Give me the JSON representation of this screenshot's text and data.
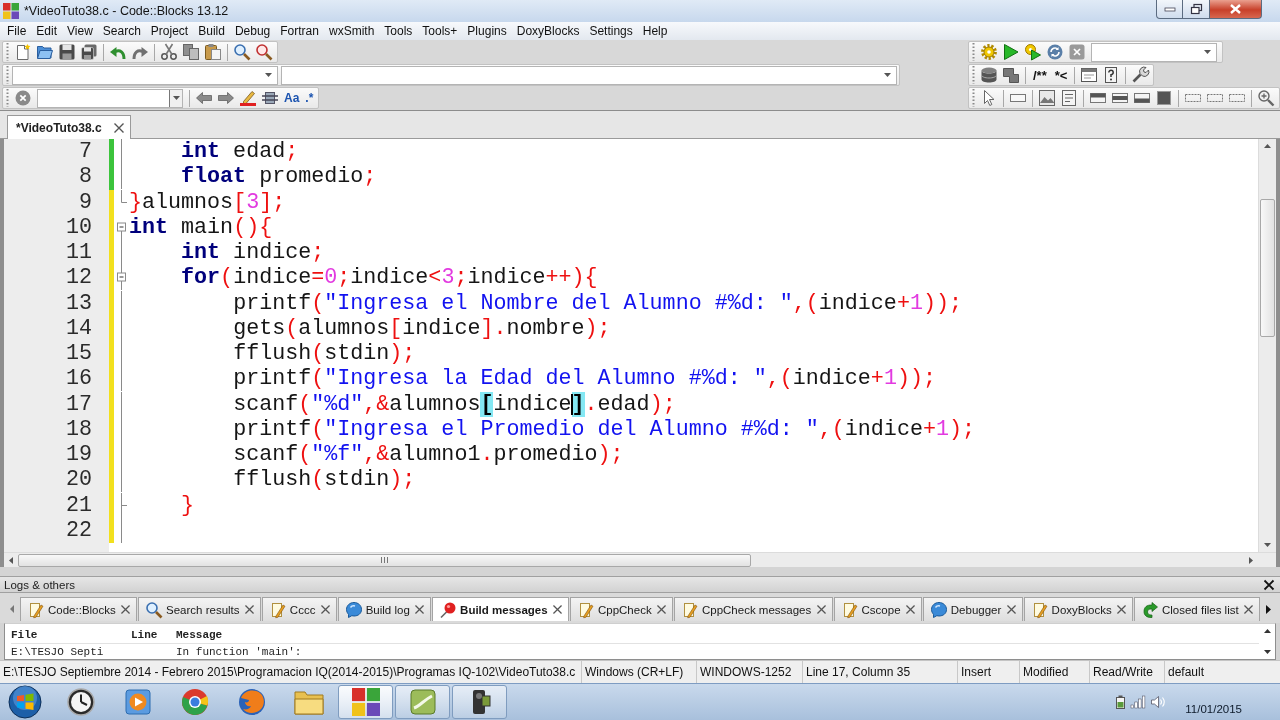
{
  "window": {
    "title": "*VideoTuto38.c - Code::Blocks 13.12"
  },
  "menu": [
    "File",
    "Edit",
    "View",
    "Search",
    "Project",
    "Build",
    "Debug",
    "Fortran",
    "wxSmith",
    "Tools",
    "Tools+",
    "Plugins",
    "DoxyBlocks",
    "Settings",
    "Help"
  ],
  "search_toolbar": {
    "buttons": [
      "Aa",
      ".*"
    ]
  },
  "doxyblocks_toolbar": {
    "buttons": [
      "/**",
      "*<"
    ]
  },
  "editor_tabs": [
    {
      "label": "*VideoTuto38.c",
      "selected": true
    }
  ],
  "editor": {
    "lines": [
      {
        "number": "7",
        "saved": true,
        "fold_start": false,
        "fold_end": false,
        "tokens": [
          {
            "kind": "keyword",
            "text": "    int"
          },
          {
            "kind": "plain",
            "text": " edad"
          },
          {
            "kind": "operator",
            "text": ";"
          }
        ]
      },
      {
        "number": "8",
        "saved": true,
        "fold_start": false,
        "fold_end": false,
        "tokens": [
          {
            "kind": "keyword",
            "text": "    float"
          },
          {
            "kind": "plain",
            "text": " promedio"
          },
          {
            "kind": "operator",
            "text": ";"
          }
        ]
      },
      {
        "number": "9",
        "saved": false,
        "fold_start": false,
        "fold_end": true,
        "tokens": [
          {
            "kind": "operator",
            "text": "}"
          },
          {
            "kind": "plain",
            "text": "alumnos"
          },
          {
            "kind": "operator",
            "text": "["
          },
          {
            "kind": "number",
            "text": "3"
          },
          {
            "kind": "operator",
            "text": "];"
          }
        ]
      },
      {
        "number": "10",
        "saved": false,
        "fold_start": true,
        "fold_end": false,
        "tokens": [
          {
            "kind": "keyword",
            "text": "int"
          },
          {
            "kind": "plain",
            "text": " main"
          },
          {
            "kind": "operator",
            "text": "(){"
          }
        ]
      },
      {
        "number": "11",
        "saved": false,
        "fold_start": false,
        "fold_end": false,
        "tokens": [
          {
            "kind": "keyword",
            "text": "    int"
          },
          {
            "kind": "plain",
            "text": " indice"
          },
          {
            "kind": "operator",
            "text": ";"
          }
        ]
      },
      {
        "number": "12",
        "saved": false,
        "fold_start": true,
        "fold_end": false,
        "tokens": [
          {
            "kind": "keyword",
            "text": "    for"
          },
          {
            "kind": "operator",
            "text": "("
          },
          {
            "kind": "plain",
            "text": "indice"
          },
          {
            "kind": "operator",
            "text": "="
          },
          {
            "kind": "number",
            "text": "0"
          },
          {
            "kind": "operator",
            "text": ";"
          },
          {
            "kind": "plain",
            "text": "indice"
          },
          {
            "kind": "operator",
            "text": "<"
          },
          {
            "kind": "number",
            "text": "3"
          },
          {
            "kind": "operator",
            "text": ";"
          },
          {
            "kind": "plain",
            "text": "indice"
          },
          {
            "kind": "operator",
            "text": "++){"
          }
        ]
      },
      {
        "number": "13",
        "saved": false,
        "fold_start": false,
        "fold_end": false,
        "tokens": [
          {
            "kind": "plain",
            "text": "        printf"
          },
          {
            "kind": "operator",
            "text": "("
          },
          {
            "kind": "string",
            "text": "\"Ingresa el Nombre del Alumno #%d: \""
          },
          {
            "kind": "operator",
            "text": ",("
          },
          {
            "kind": "plain",
            "text": "indice"
          },
          {
            "kind": "operator",
            "text": "+"
          },
          {
            "kind": "number",
            "text": "1"
          },
          {
            "kind": "operator",
            "text": "));"
          }
        ]
      },
      {
        "number": "14",
        "saved": false,
        "fold_start": false,
        "fold_end": false,
        "tokens": [
          {
            "kind": "plain",
            "text": "        gets"
          },
          {
            "kind": "operator",
            "text": "("
          },
          {
            "kind": "plain",
            "text": "alumnos"
          },
          {
            "kind": "operator",
            "text": "["
          },
          {
            "kind": "plain",
            "text": "indice"
          },
          {
            "kind": "operator",
            "text": "]."
          },
          {
            "kind": "plain",
            "text": "nombre"
          },
          {
            "kind": "operator",
            "text": ");"
          }
        ]
      },
      {
        "number": "15",
        "saved": false,
        "fold_start": false,
        "fold_end": false,
        "tokens": [
          {
            "kind": "plain",
            "text": "        fflush"
          },
          {
            "kind": "operator",
            "text": "("
          },
          {
            "kind": "plain",
            "text": "stdin"
          },
          {
            "kind": "operator",
            "text": ");"
          }
        ]
      },
      {
        "number": "16",
        "saved": false,
        "fold_start": false,
        "fold_end": false,
        "tokens": [
          {
            "kind": "plain",
            "text": "        printf"
          },
          {
            "kind": "operator",
            "text": "("
          },
          {
            "kind": "string",
            "text": "\"Ingresa la Edad del Alumno #%d: \""
          },
          {
            "kind": "operator",
            "text": ",("
          },
          {
            "kind": "plain",
            "text": "indice"
          },
          {
            "kind": "operator",
            "text": "+"
          },
          {
            "kind": "number",
            "text": "1"
          },
          {
            "kind": "operator",
            "text": "));"
          }
        ]
      },
      {
        "number": "17",
        "saved": false,
        "fold_start": false,
        "fold_end": false,
        "tokens": [
          {
            "kind": "plain",
            "text": "        scanf"
          },
          {
            "kind": "operator",
            "text": "("
          },
          {
            "kind": "string",
            "text": "\"%d\""
          },
          {
            "kind": "operator",
            "text": ",&"
          },
          {
            "kind": "plain",
            "text": "alumnos"
          },
          {
            "kind": "brace",
            "text": "["
          },
          {
            "kind": "plain",
            "text": "indice"
          },
          {
            "kind": "caret"
          },
          {
            "kind": "brace",
            "text": "]"
          },
          {
            "kind": "operator",
            "text": "."
          },
          {
            "kind": "plain",
            "text": "edad"
          },
          {
            "kind": "operator",
            "text": ");"
          }
        ]
      },
      {
        "number": "18",
        "saved": false,
        "fold_start": false,
        "fold_end": false,
        "tokens": [
          {
            "kind": "plain",
            "text": "        printf"
          },
          {
            "kind": "operator",
            "text": "("
          },
          {
            "kind": "string",
            "text": "\"Ingresa el Promedio del Alumno #%d: \""
          },
          {
            "kind": "operator",
            "text": ",("
          },
          {
            "kind": "plain",
            "text": "indice"
          },
          {
            "kind": "operator",
            "text": "+"
          },
          {
            "kind": "number",
            "text": "1"
          },
          {
            "kind": "operator",
            "text": ");"
          }
        ]
      },
      {
        "number": "19",
        "saved": false,
        "fold_start": false,
        "fold_end": false,
        "tokens": [
          {
            "kind": "plain",
            "text": "        scanf"
          },
          {
            "kind": "operator",
            "text": "("
          },
          {
            "kind": "string",
            "text": "\"%f\""
          },
          {
            "kind": "operator",
            "text": ",&"
          },
          {
            "kind": "plain",
            "text": "alumno1"
          },
          {
            "kind": "operator",
            "text": "."
          },
          {
            "kind": "plain",
            "text": "promedio"
          },
          {
            "kind": "operator",
            "text": ");"
          }
        ]
      },
      {
        "number": "20",
        "saved": false,
        "fold_start": false,
        "fold_end": false,
        "tokens": [
          {
            "kind": "plain",
            "text": "        fflush"
          },
          {
            "kind": "operator",
            "text": "("
          },
          {
            "kind": "plain",
            "text": "stdin"
          },
          {
            "kind": "operator",
            "text": ");"
          }
        ]
      },
      {
        "number": "21",
        "saved": false,
        "fold_start": false,
        "fold_end": true,
        "tokens": [
          {
            "kind": "operator",
            "text": "    }"
          }
        ]
      },
      {
        "number": "22",
        "saved": false,
        "fold_start": false,
        "fold_end": false
      }
    ]
  },
  "logs_panel": {
    "title": "Logs & others",
    "tabs": [
      {
        "label": "Code::Blocks",
        "kind": "log",
        "selected": false
      },
      {
        "label": "Search results",
        "kind": "search",
        "selected": false
      },
      {
        "label": "Cccc",
        "kind": "log",
        "selected": false
      },
      {
        "label": "Build log",
        "kind": "process",
        "selected": false
      },
      {
        "label": "Build messages",
        "kind": "alert",
        "selected": true
      },
      {
        "label": "CppCheck",
        "kind": "log",
        "selected": false
      },
      {
        "label": "CppCheck messages",
        "kind": "log",
        "selected": false
      },
      {
        "label": "Cscope",
        "kind": "log",
        "selected": false
      },
      {
        "label": "Debugger",
        "kind": "process",
        "selected": false
      },
      {
        "label": "DoxyBlocks",
        "kind": "log",
        "selected": false
      },
      {
        "label": "Closed files list",
        "kind": "history",
        "selected": false
      }
    ],
    "columns": [
      "File",
      "Line",
      "Message"
    ],
    "rows": [
      {
        "file": "E:\\TESJO Septi",
        "message": "In function 'main':"
      }
    ]
  },
  "status_bar": {
    "path": "E:\\TESJO Septiembre 2014 - Febrero 2015\\Programacion IQ(2014-2015)\\Programas IQ-102\\VideoTuto38.c",
    "line_endings": "Windows (CR+LF)",
    "encoding": "WINDOWS-1252",
    "position": "Line 17, Column 35",
    "mode": "Insert",
    "modified": "Modified",
    "access": "Read/Write",
    "profile": "default"
  },
  "taskbar": {
    "apps": [
      {
        "kind": "clock",
        "open": false,
        "active": false
      },
      {
        "kind": "player",
        "open": false,
        "active": false
      },
      {
        "kind": "browser",
        "open": false,
        "active": false
      },
      {
        "kind": "web",
        "open": false,
        "active": false
      },
      {
        "kind": "folder",
        "open": false,
        "active": false
      },
      {
        "kind": "ide",
        "open": true,
        "active": true
      },
      {
        "kind": "notes",
        "open": true,
        "active": false
      },
      {
        "kind": "camera",
        "open": true,
        "active": false
      }
    ],
    "date": "11/01/2015"
  }
}
